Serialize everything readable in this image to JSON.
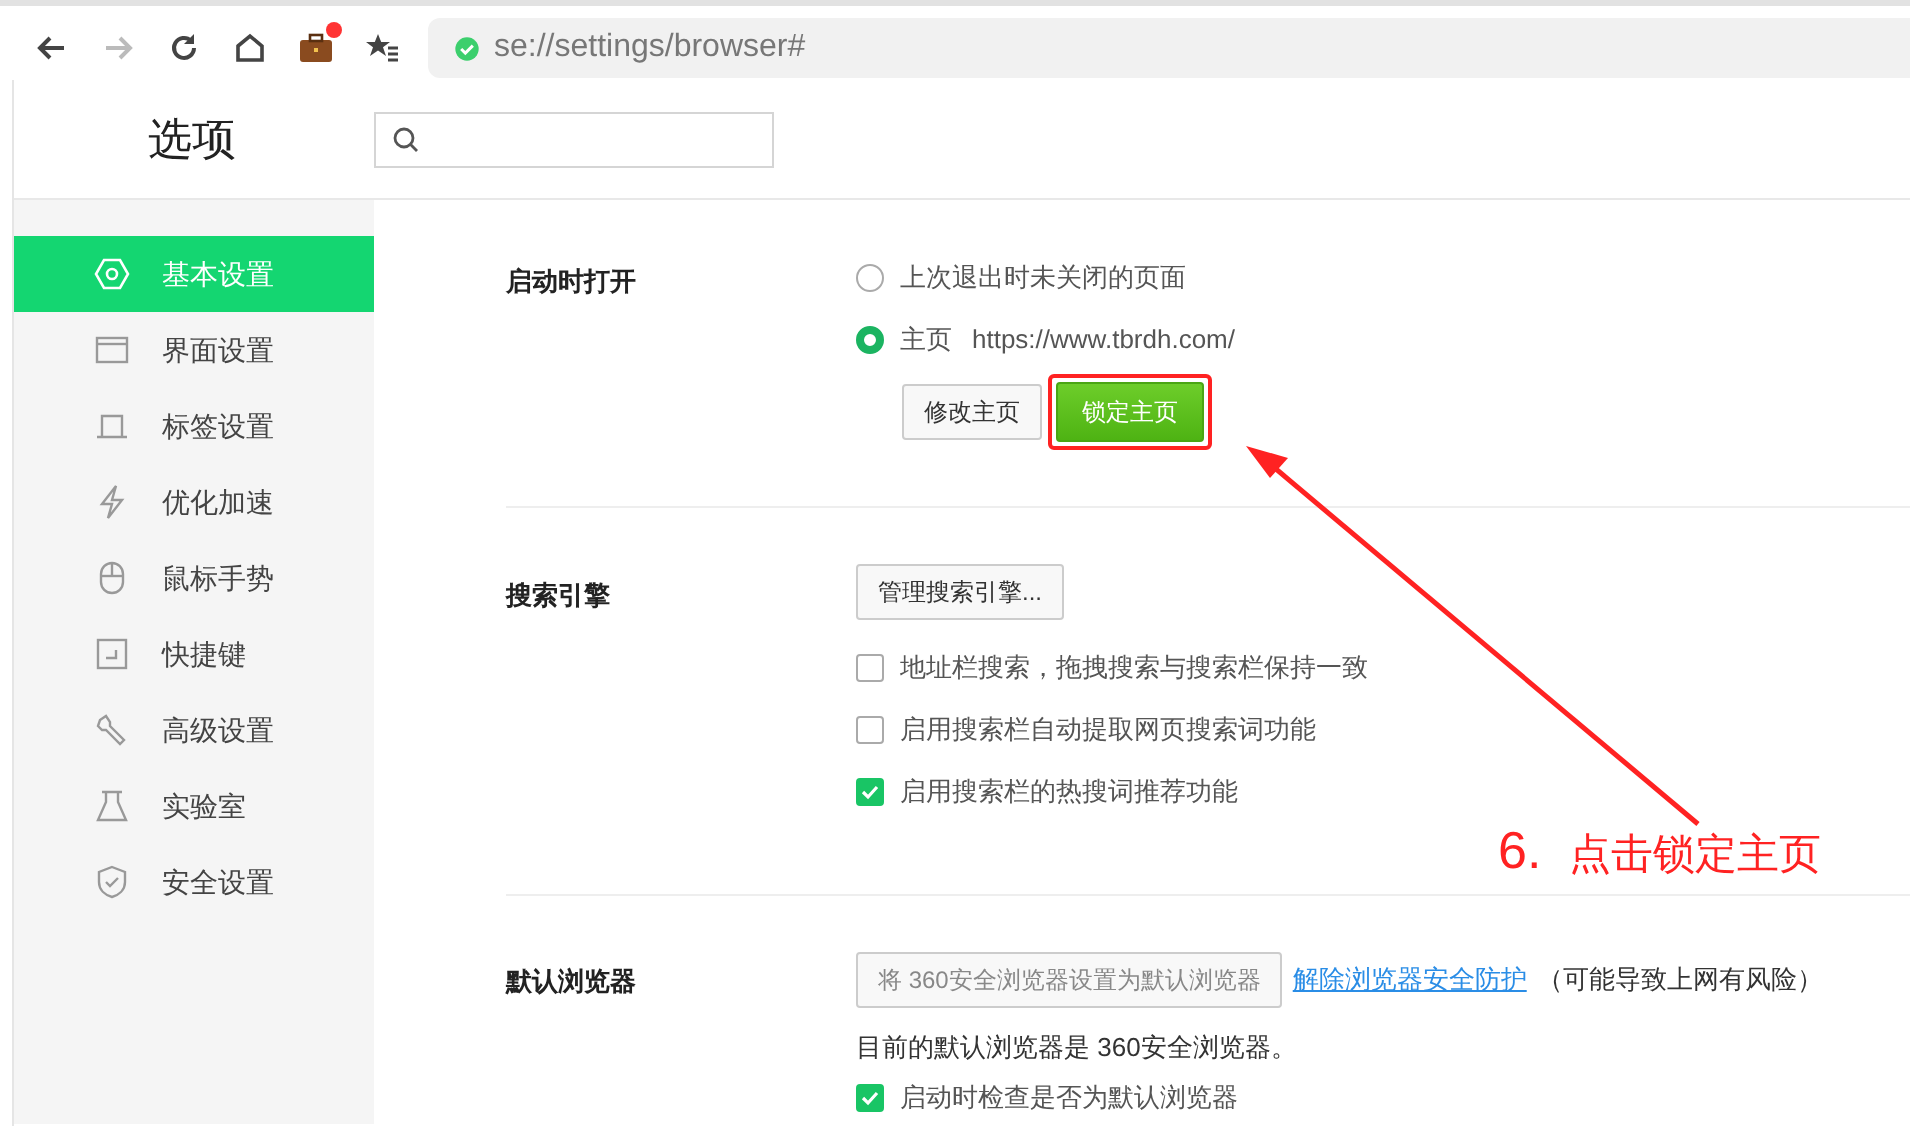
{
  "toolbar": {
    "buttons": [
      {
        "kind": "back",
        "disabled": false
      },
      {
        "kind": "forward",
        "disabled": true
      },
      {
        "kind": "reload",
        "disabled": false
      },
      {
        "kind": "home",
        "disabled": false
      },
      {
        "kind": "briefcase",
        "disabled": false,
        "badge": true
      },
      {
        "kind": "favorites",
        "disabled": false
      }
    ],
    "address": "se://settings/browser#"
  },
  "header": {
    "title": "选项"
  },
  "sidebar": {
    "items": [
      {
        "label": "基本设置",
        "kind": "gear",
        "selected": true
      },
      {
        "label": "界面设置",
        "kind": "window",
        "selected": false
      },
      {
        "label": "标签设置",
        "kind": "tab",
        "selected": false
      },
      {
        "label": "优化加速",
        "kind": "bolt",
        "selected": false
      },
      {
        "label": "鼠标手势",
        "kind": "mouse",
        "selected": false
      },
      {
        "label": "快捷键",
        "kind": "key",
        "selected": false
      },
      {
        "label": "高级设置",
        "kind": "wrench",
        "selected": false
      },
      {
        "label": "实验室",
        "kind": "flask",
        "selected": false
      },
      {
        "label": "安全设置",
        "kind": "shield",
        "selected": false
      }
    ]
  },
  "sections": [
    {
      "kind": "startup",
      "label": "启动时打开",
      "options": [
        {
          "label": "上次退出时未关闭的页面",
          "selected": false
        },
        {
          "label": "主页",
          "url": "https://www.tbrdh.com/",
          "selected": true
        }
      ],
      "buttons": [
        {
          "label": "修改主页",
          "primary": false,
          "highlighted": false
        },
        {
          "label": "锁定主页",
          "primary": true,
          "highlighted": true
        }
      ]
    },
    {
      "kind": "search",
      "label": "搜索引擎",
      "button": "管理搜索引擎...",
      "checkboxes": [
        {
          "label": "地址栏搜索，拖拽搜索与搜索栏保持一致",
          "checked": false
        },
        {
          "label": "启用搜索栏自动提取网页搜索词功能",
          "checked": false
        },
        {
          "label": "启用搜索栏的热搜词推荐功能",
          "checked": true
        }
      ]
    },
    {
      "kind": "default",
      "label": "默认浏览器",
      "set_button": "将 360安全浏览器设置为默认浏览器",
      "link": "解除浏览器安全防护",
      "note": "（可能导致上网有风险）",
      "status": "目前的默认浏览器是 360安全浏览器。",
      "checkboxes": [
        {
          "label": "启动时检查是否为默认浏览器",
          "checked": true
        }
      ]
    }
  ],
  "annotation": {
    "step": "6.",
    "text": "点击锁定主页"
  }
}
